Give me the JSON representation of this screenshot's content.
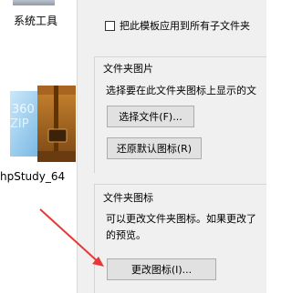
{
  "desktop": {
    "icons": [
      {
        "label": "系统工具"
      },
      {
        "label": "hpStudy_64"
      }
    ],
    "php_icon_text": "360"
  },
  "dialog": {
    "apply_subfolders_label": "把此模板应用到所有子文件夹",
    "apply_subfolders_checked": false,
    "folder_pictures": {
      "title": "文件夹图片",
      "description": "选择要在此文件夹图标上显示的文",
      "choose_file_button": "选择文件(F)...",
      "restore_default_button": "还原默认图标(R)"
    },
    "folder_icons": {
      "title": "文件夹图标",
      "description_line1": "可以更改文件夹图标。如果更改了",
      "description_line2": "的预览。",
      "change_icon_button": "更改图标(I)..."
    }
  },
  "annotation": {
    "arrow_color": "#e53935"
  }
}
